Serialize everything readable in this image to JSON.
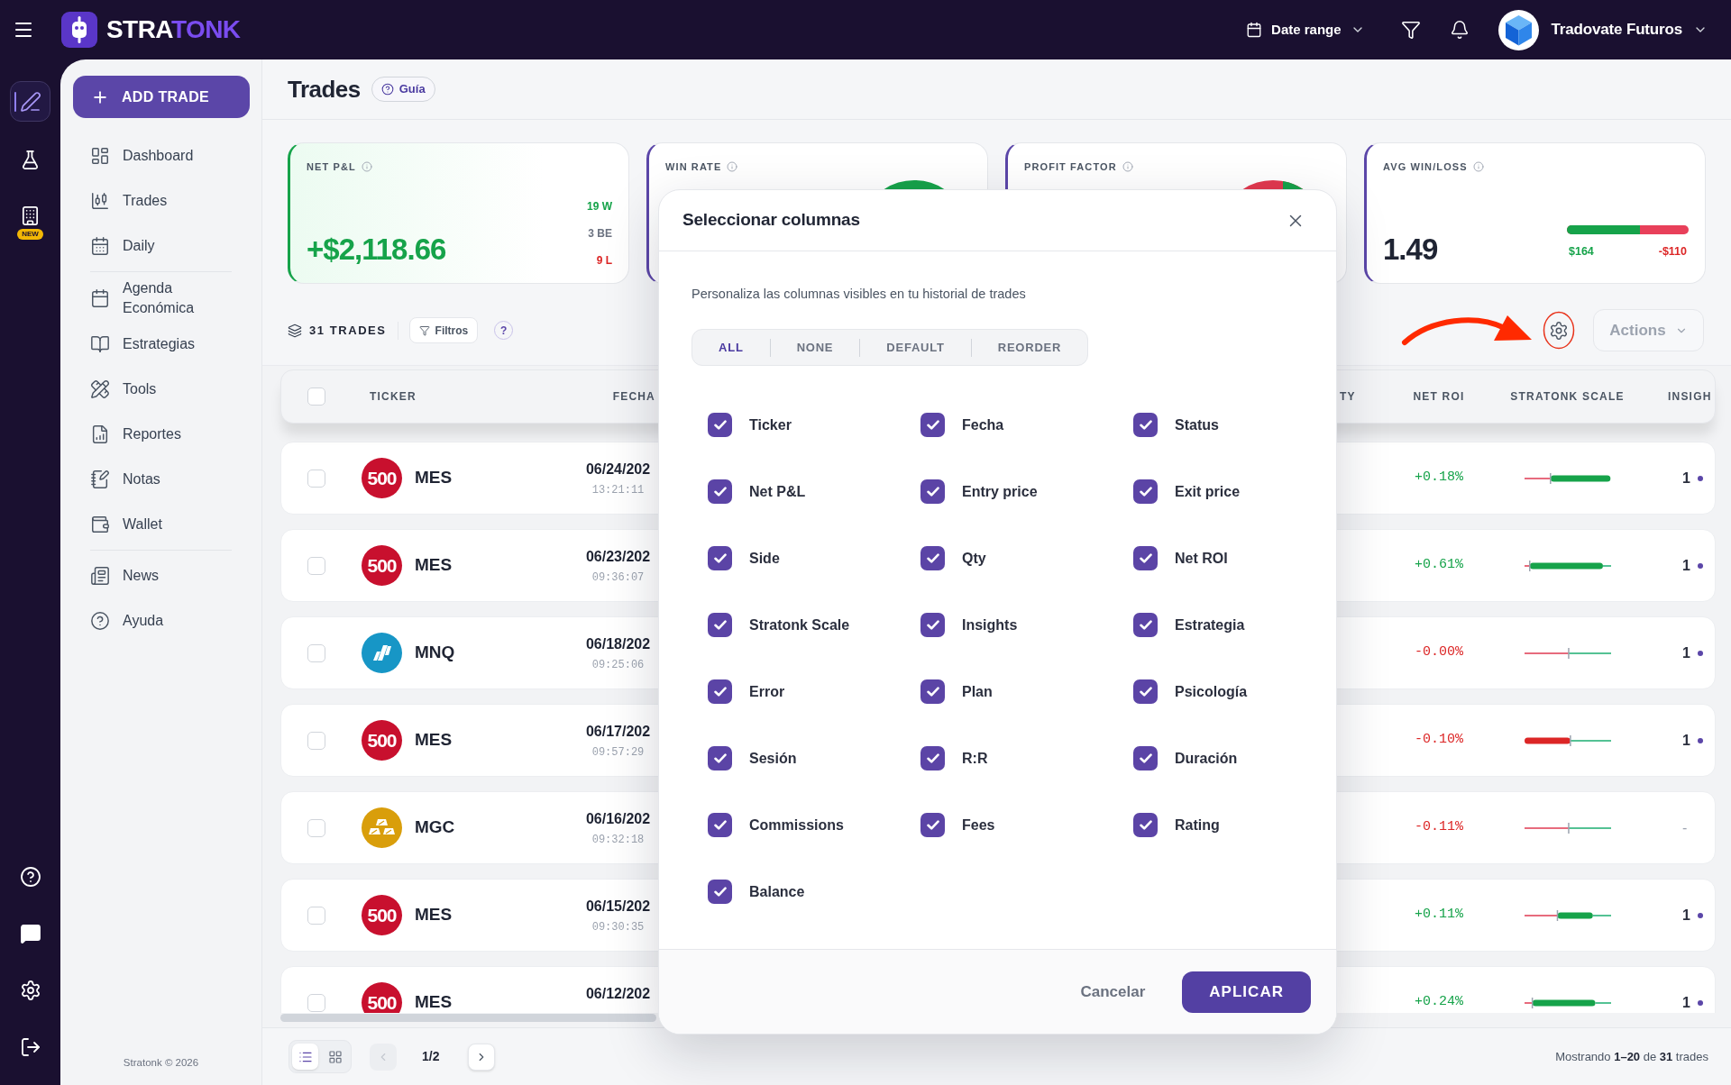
{
  "top_bar": {
    "brand": [
      "STRA",
      "TONK"
    ],
    "date_range": "Date range",
    "account": "Tradovate Futuros"
  },
  "rail": {
    "items": [
      {
        "kind": "edit",
        "selected": true
      },
      {
        "kind": "lab",
        "selected": false
      },
      {
        "kind": "reports",
        "selected": false,
        "badge": "NEW"
      }
    ],
    "bottom": [
      {
        "kind": "help"
      },
      {
        "kind": "chat"
      },
      {
        "kind": "settings"
      },
      {
        "kind": "logout"
      }
    ]
  },
  "sidebar": {
    "add_button": "ADD TRADE",
    "groups": [
      [
        {
          "kind": "dashboard",
          "label": "Dashboard"
        },
        {
          "kind": "trades",
          "label": "Trades"
        },
        {
          "kind": "daily",
          "label": "Daily"
        }
      ],
      [
        {
          "kind": "calendar",
          "label": "Agenda Económica"
        },
        {
          "kind": "book",
          "label": "Estrategias"
        },
        {
          "kind": "tools",
          "label": "Tools"
        },
        {
          "kind": "report",
          "label": "Reportes"
        },
        {
          "kind": "notes",
          "label": "Notas"
        },
        {
          "kind": "wallet",
          "label": "Wallet"
        }
      ],
      [
        {
          "kind": "news",
          "label": "News"
        },
        {
          "kind": "help",
          "label": "Ayuda"
        }
      ]
    ],
    "footer": "Stratonk © 2026"
  },
  "page": {
    "title": "Trades",
    "guide_button": "Guía"
  },
  "stats": [
    {
      "kind": "pnl",
      "label": "NET P&L",
      "value": "+$2,118.66",
      "breakdown": [
        {
          "text": "19 W",
          "color": "#16a34a"
        },
        {
          "text": "3 BE",
          "color": "#6b7280"
        },
        {
          "text": "9 L",
          "color": "#dc2626"
        }
      ]
    },
    {
      "kind": "ring",
      "label": "WIN RATE"
    },
    {
      "kind": "split",
      "label": "PROFIT FACTOR"
    },
    {
      "kind": "ratio",
      "label": "AVG WIN/LOSS",
      "value": "1.49",
      "bar": {
        "level": 0.6
      },
      "win": "$164",
      "loss": "-$110"
    }
  ],
  "toolbar": {
    "count": "31 TRADES",
    "filter_button": "Filtros",
    "help_button": "?",
    "actions_button": "Actions"
  },
  "table": {
    "select_all": {
      "checked": false
    },
    "columns": [
      {
        "label": "TICKER"
      },
      {
        "label": "FECHA"
      },
      {
        "label": "TY"
      },
      {
        "label": "NET ROI"
      },
      {
        "label": "STRATONK SCALE"
      },
      {
        "label": "INSIGH"
      }
    ],
    "rows": [
      {
        "selected": false,
        "logo": {
          "kind": "sp500",
          "text": "500"
        },
        "ticker": "MES",
        "date": "06/24/202",
        "time": "13:21:11",
        "net_roi": {
          "text": "+0.18%",
          "color": "#16a34a"
        },
        "scale": {
          "marker": {
            "level": 0.3
          },
          "gain": {
            "level": 0.99
          }
        },
        "insights": {
          "text": "1",
          "dot": true
        }
      },
      {
        "selected": false,
        "logo": {
          "kind": "sp500",
          "text": "500"
        },
        "ticker": "MES",
        "date": "06/23/202",
        "time": "09:36:07",
        "net_roi": {
          "text": "+0.61%",
          "color": "#16a34a"
        },
        "scale": {
          "marker": {
            "level": 0.06
          },
          "gain": {
            "level": 0.9
          }
        },
        "insights": {
          "text": "1",
          "dot": true
        }
      },
      {
        "selected": false,
        "logo": {
          "kind": "nasdaq"
        },
        "ticker": "MNQ",
        "date": "06/18/202",
        "time": "09:25:06",
        "net_roi": {
          "text": "-0.00%",
          "color": "#dc2626"
        },
        "scale": {
          "marker": {
            "level": 0.51
          }
        },
        "insights": {
          "text": "1",
          "dot": true
        }
      },
      {
        "selected": false,
        "logo": {
          "kind": "sp500",
          "text": "500"
        },
        "ticker": "MES",
        "date": "06/17/202",
        "time": "09:57:29",
        "net_roi": {
          "text": "-0.10%",
          "color": "#dc2626"
        },
        "scale": {
          "marker": {
            "level": 0.53
          },
          "loss": {
            "level": 1
          }
        },
        "insights": {
          "text": "1",
          "dot": true
        }
      },
      {
        "selected": false,
        "logo": {
          "kind": "gold"
        },
        "ticker": "MGC",
        "date": "06/16/202",
        "time": "09:32:18",
        "net_roi": {
          "text": "-0.11%",
          "color": "#dc2626"
        },
        "scale": {
          "marker": {
            "level": 0.51
          }
        },
        "insights": {
          "text": "-",
          "dot": false
        }
      },
      {
        "selected": false,
        "logo": {
          "kind": "sp500",
          "text": "500"
        },
        "ticker": "MES",
        "date": "06/15/202",
        "time": "09:30:35",
        "net_roi": {
          "text": "+0.11%",
          "color": "#16a34a"
        },
        "scale": {
          "marker": {
            "level": 0.38
          },
          "gain": {
            "level": 0.66
          }
        },
        "insights": {
          "text": "1",
          "dot": true
        }
      },
      {
        "selected": false,
        "logo": {
          "kind": "sp500",
          "text": "500"
        },
        "ticker": "MES",
        "date": "06/12/202",
        "net_roi": {
          "text": "+0.24%",
          "color": "#16a34a"
        },
        "scale": {
          "marker": {
            "level": 0.09
          },
          "gain": {
            "level": 0.8
          }
        },
        "insights": {
          "text": "1",
          "dot": true
        }
      }
    ]
  },
  "pagination": {
    "views": [
      {
        "kind": "list",
        "selected": true
      },
      {
        "kind": "grid",
        "selected": false
      }
    ],
    "previous": {
      "disabled": true
    },
    "page": "1/2",
    "next": {
      "disabled": false
    },
    "summary": "Mostrando **1–20** de **31** trades"
  },
  "modal": {
    "title": "Seleccionar columnas",
    "description": "Personaliza las columnas visibles en tu historial de trades",
    "presets": [
      {
        "label": "ALL",
        "selected": true
      },
      {
        "label": "NONE",
        "selected": false
      },
      {
        "label": "DEFAULT",
        "selected": false
      },
      {
        "label": "REORDER",
        "selected": false
      }
    ],
    "options": [
      {
        "label": "Ticker",
        "checked": true
      },
      {
        "label": "Fecha",
        "checked": true
      },
      {
        "label": "Status",
        "checked": true
      },
      {
        "label": "Net P&L",
        "checked": true
      },
      {
        "label": "Entry price",
        "checked": true
      },
      {
        "label": "Exit price",
        "checked": true
      },
      {
        "label": "Side",
        "checked": true
      },
      {
        "label": "Qty",
        "checked": true
      },
      {
        "label": "Net ROI",
        "checked": true
      },
      {
        "label": "Stratonk Scale",
        "checked": true
      },
      {
        "label": "Insights",
        "checked": true
      },
      {
        "label": "Estrategia",
        "checked": true
      },
      {
        "label": "Error",
        "checked": true
      },
      {
        "label": "Plan",
        "checked": true
      },
      {
        "label": "Psicología",
        "checked": true
      },
      {
        "label": "Sesión",
        "checked": true
      },
      {
        "label": "R:R",
        "checked": true
      },
      {
        "label": "Duración",
        "checked": true
      },
      {
        "label": "Commissions",
        "checked": true
      },
      {
        "label": "Fees",
        "checked": true
      },
      {
        "label": "Rating",
        "checked": true
      },
      {
        "label": "Balance",
        "checked": true
      }
    ],
    "cancel_button": "Cancelar",
    "apply_button": "APLICAR"
  }
}
